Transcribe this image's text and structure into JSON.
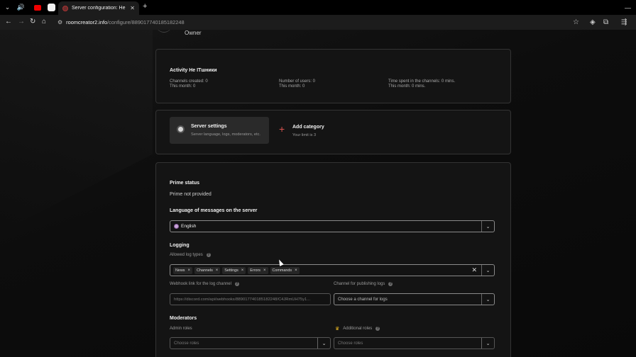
{
  "browser": {
    "tab_title": "Server configuration: Не ITшн",
    "url_host": "roomcreator2.info",
    "url_path": "/configure/889017740185182248"
  },
  "owner_label": "Owner",
  "activity": {
    "title": "Activity Не ITшники",
    "channels_created": "Channels created: 0",
    "channels_month": "This month: 0",
    "users": "Number of users: 0",
    "users_month": "This month: 0",
    "time_spent": "Time spent in the channels: 0 mins.",
    "time_month": "This month: 0 mins."
  },
  "tools": {
    "server_settings_title": "Server settings",
    "server_settings_sub": "Server language, logs, moderators, etc.",
    "add_category_title": "Add category",
    "add_category_sub": "Your limit is 3"
  },
  "settings": {
    "prime_title": "Prime status",
    "prime_value": "Prime not provided",
    "language_title": "Language of messages on the server",
    "language_value": "English",
    "logging_title": "Logging",
    "allowed_log_types_label": "Allowed log types",
    "log_types": [
      "News",
      "Channels",
      "Settings",
      "Errors",
      "Commands"
    ],
    "webhook_label": "Webhook link for the log channel",
    "webhook_value": "https://discord.com/api/webhooks/889017740185182248/C4JRmUH75y1...",
    "channel_logs_label": "Channel for publishing logs",
    "channel_logs_placeholder": "Choose a channel for logs",
    "moderators_title": "Moderators",
    "admin_roles_label": "Admin roles",
    "admin_roles_placeholder": "Choose roles",
    "additional_roles_label": "Additional roles",
    "additional_roles_placeholder": "Choose roles"
  }
}
